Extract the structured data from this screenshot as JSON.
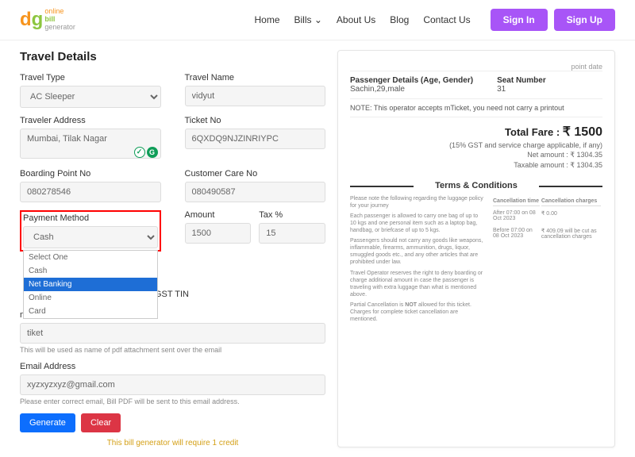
{
  "header": {
    "nav": [
      "Home",
      "Bills",
      "About Us",
      "Blog",
      "Contact Us"
    ],
    "signin": "Sign In",
    "signup": "Sign Up"
  },
  "form": {
    "title": "Travel Details",
    "travel_type_label": "Travel Type",
    "travel_type_value": "AC Sleeper",
    "travel_name_label": "Travel Name",
    "travel_name_value": "vidyut",
    "traveler_addr_label": "Traveler Address",
    "traveler_addr_value": "Mumbai, Tilak Nagar",
    "ticket_no_label": "Ticket No",
    "ticket_no_value": "6QXDQ9NJZINRIYPC",
    "boarding_label": "Boarding Point No",
    "boarding_value": "080278546",
    "cc_label": "Customer Care No",
    "cc_value": "080490587",
    "payment_label": "Payment Method",
    "payment_value": "Cash",
    "payment_options": [
      "Select One",
      "Cash",
      "Net Banking",
      "Online",
      "Card"
    ],
    "amount_label": "Amount",
    "amount_value": "1500",
    "tax_label": "Tax %",
    "tax_value": "15",
    "gst_label": "GST TIN",
    "filename_label": "me",
    "filename_value": "tiket",
    "filename_note": "This will be used as name of pdf attachment sent over the email",
    "email_label": "Email Address",
    "email_value": "xyzxyzxyz@gmail.com",
    "email_note": "Please enter correct email, Bill PDF will be sent to this email address.",
    "generate": "Generate",
    "clear": "Clear",
    "credit_note": "This bill generator will require 1 credit"
  },
  "preview": {
    "point_date": "point date",
    "passenger_label": "Passenger Details (Age, Gender)",
    "passenger_value": "Sachin,29,male",
    "seat_label": "Seat Number",
    "seat_value": "31",
    "note": "NOTE: This operator accepts mTicket, you need not carry a printout",
    "total_fare_label": "Total Fare :",
    "total_fare_value": "₹ 1500",
    "gst_note": "(15% GST and service charge applicable, if any)",
    "net_amount": "Net amount : ₹ 1304.35",
    "taxable": "Taxable amount : ₹ 1304.35",
    "tc_title": "Terms & Conditions",
    "tc_intro": "Please note the following regarding the luggage policy for your journey",
    "tc_p1": "Each passenger is allowed to carry one bag of up to 10 kgs and one personal item such as a laptop bag, handbag, or briefcase of up to 5 kgs.",
    "tc_p2": "Passengers should not carry any goods like weapons, inflammable, firearms, ammunition, drugs, liquor, smuggled goods etc., and any other articles that are prohibited under law.",
    "tc_p3": "Travel Operator reserves the right to deny boarding or charge additional amount in case the passenger is traveling with extra luggage than what is mentioned above.",
    "tc_p4_a": "Partial Cancellation is ",
    "tc_p4_b": "NOT",
    "tc_p4_c": " allowed for this ticket. Charges for complete ticket cancellation are mentioned.",
    "tc_th1": "Cancellation time",
    "tc_th2": "Cancellation charges",
    "tc_r1_time": "After 07:00 on 08 Oct 2023",
    "tc_r1_charge": "₹ 0.00",
    "tc_r2_time": "Before 07:00 on 08 Oct 2023",
    "tc_r2_charge": "₹ 409.09 will be cut as cancellation charges"
  }
}
